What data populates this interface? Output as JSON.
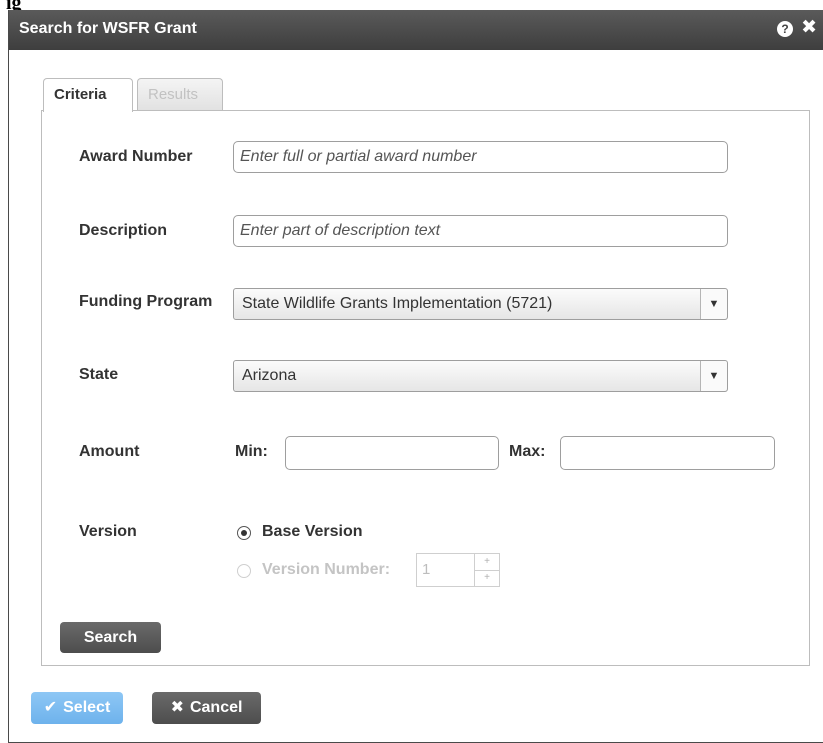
{
  "caption": "ig",
  "dialog": {
    "title": "Search for WSFR Grant",
    "help_glyph": "?",
    "close_glyph": "✖"
  },
  "tabs": [
    {
      "label": "Criteria",
      "active": true
    },
    {
      "label": "Results",
      "active": false
    }
  ],
  "form": {
    "award_number": {
      "label": "Award Number",
      "value": "",
      "placeholder": "Enter full or partial award number"
    },
    "description": {
      "label": "Description",
      "value": "",
      "placeholder": "Enter part of description text"
    },
    "funding_program": {
      "label": "Funding Program",
      "selected": "State Wildlife Grants Implementation (5721)"
    },
    "state": {
      "label": "State",
      "selected": "Arizona"
    },
    "amount": {
      "label": "Amount",
      "min_label": "Min:",
      "max_label": "Max:",
      "min": "",
      "max": ""
    },
    "version": {
      "label": "Version",
      "base_label": "Base Version",
      "number_label": "Version Number:",
      "number_value": "1",
      "selected": "base"
    },
    "search_label": "Search"
  },
  "footer": {
    "select_label": "Select",
    "cancel_label": "Cancel"
  },
  "colors": {
    "titlebar": "#4a4a4a",
    "select_button": "#7dbcf0",
    "dark_button": "#5a5a5a"
  },
  "icons": {
    "help": "help-icon",
    "close": "close-icon",
    "select": "checkmark-icon",
    "cancel": "x-icon",
    "dropdown": "chevron-down-icon"
  }
}
